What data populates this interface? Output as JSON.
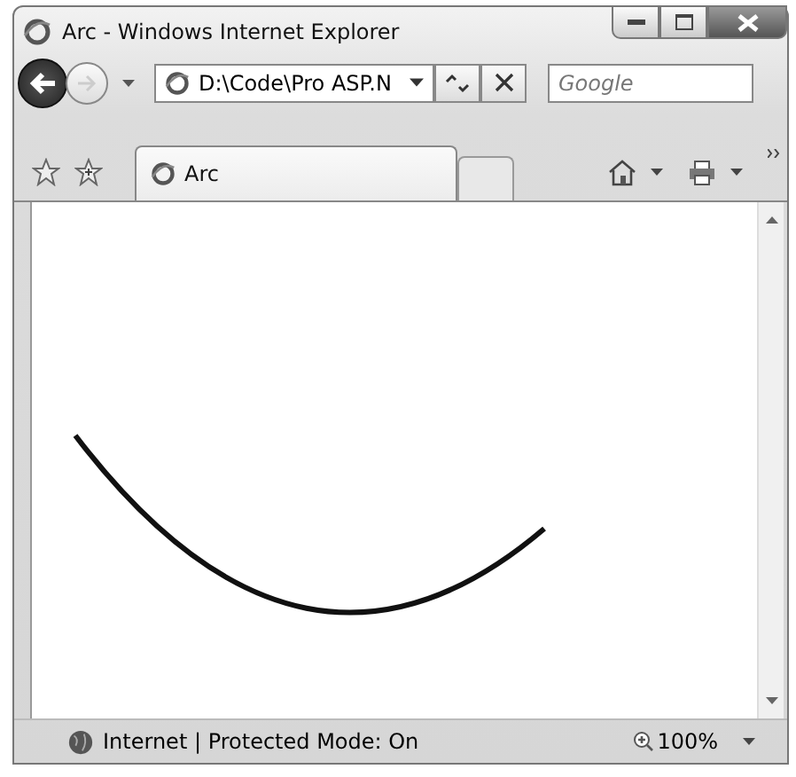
{
  "window": {
    "title": "Arc - Windows Internet Explorer"
  },
  "address_bar": {
    "value": "D:\\Code\\Pro ASP.N"
  },
  "search": {
    "placeholder": "Google"
  },
  "tabs": [
    {
      "label": "Arc",
      "selected": true
    }
  ],
  "status_bar": {
    "zone": "Internet | Protected Mode: On",
    "zoom": "100%"
  }
}
